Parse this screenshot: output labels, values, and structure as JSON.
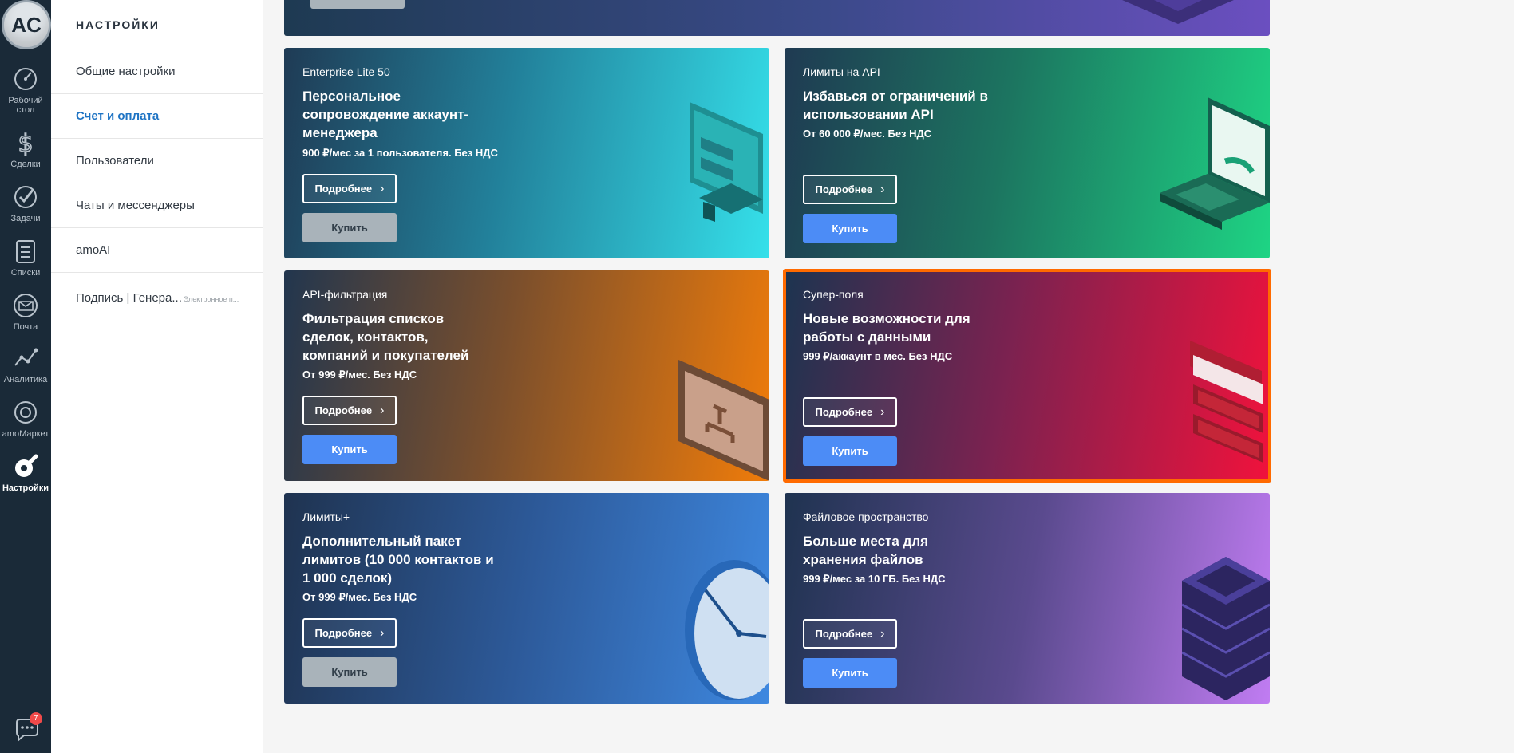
{
  "rail": {
    "avatar_text": "AC",
    "items": [
      {
        "label": "Рабочий стол",
        "icon": "dashboard-icon"
      },
      {
        "label": "Сделки",
        "icon": "dollar-icon"
      },
      {
        "label": "Задачи",
        "icon": "check-icon"
      },
      {
        "label": "Списки",
        "icon": "list-icon"
      },
      {
        "label": "Почта",
        "icon": "mail-icon"
      },
      {
        "label": "Аналитика",
        "icon": "analytics-icon"
      },
      {
        "label": "amoМаркет",
        "icon": "market-icon"
      },
      {
        "label": "Настройки",
        "icon": "settings-icon"
      }
    ],
    "chat_badge": "7"
  },
  "sidebar": {
    "title": "НАСТРОЙКИ",
    "items": [
      {
        "label": "Общие настройки"
      },
      {
        "label": "Счет и оплата"
      },
      {
        "label": "Пользователи"
      },
      {
        "label": "Чаты и мессенджеры"
      },
      {
        "label": "amoAI"
      },
      {
        "label": "Подпись | Генера...",
        "sub": "Электронное п..."
      }
    ]
  },
  "colors": {
    "rail": "#1a2a38",
    "accent_blue": "#4c8cf6",
    "active_link": "#1f74c4",
    "highlight_border": "#ff6a00"
  },
  "cards": [
    {
      "tag": "Enterprise Lite 50",
      "headline": "Персональное сопровождение аккаунт-менеджера",
      "price": "900 ₽/мес за 1 пользователя. Без НДС",
      "more": "Подробнее",
      "buy": "Купить",
      "buy_state": "disabled"
    },
    {
      "tag": "Лимиты на API",
      "headline": "Избавься от ограничений в использовании API",
      "price": "От 60 000 ₽/мес. Без НДС",
      "more": "Подробнее",
      "buy": "Купить",
      "buy_state": "enabled"
    },
    {
      "tag": "API-фильтрация",
      "headline": "Фильтрация списков сделок, контактов, компаний и покупателей",
      "price": "От 999 ₽/мес. Без НДС",
      "more": "Подробнее",
      "buy": "Купить",
      "buy_state": "enabled"
    },
    {
      "tag": "Супер-поля",
      "headline": "Новые возможности для работы с данными",
      "price": "999 ₽/аккаунт в мес. Без НДС",
      "more": "Подробнее",
      "buy": "Купить",
      "buy_state": "enabled",
      "highlighted": true
    },
    {
      "tag": "Лимиты+",
      "headline": "Дополнительный пакет лимитов (10 000 контактов и 1 000 сделок)",
      "price": "От 999 ₽/мес. Без НДС",
      "more": "Подробнее",
      "buy": "Купить",
      "buy_state": "disabled"
    },
    {
      "tag": "Файловое пространство",
      "headline": "Больше места для хранения файлов",
      "price": "999 ₽/мес за 10 ГБ. Без НДС",
      "more": "Подробнее",
      "buy": "Купить",
      "buy_state": "enabled"
    }
  ]
}
